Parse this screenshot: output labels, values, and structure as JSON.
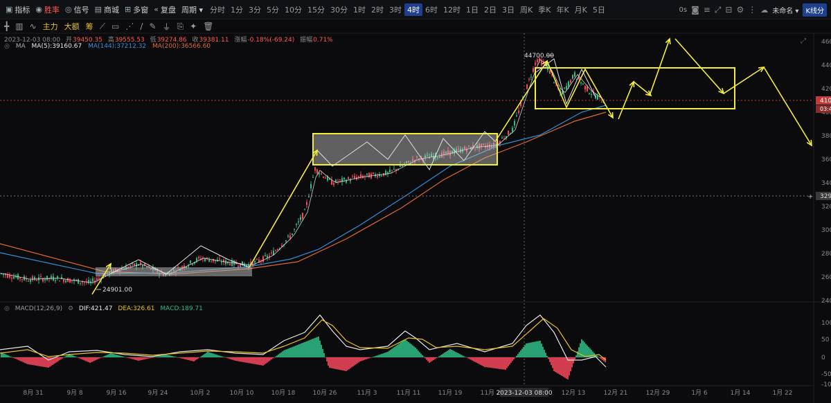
{
  "toolbar": {
    "items": [
      {
        "name": "indicators-button",
        "icon": "indicator-icon",
        "glyph": "▣",
        "label": "指标",
        "style": ""
      },
      {
        "name": "win-rate-button",
        "icon": "win-icon",
        "glyph": "◉",
        "label": "胜率",
        "style": "red"
      },
      {
        "name": "signal-button",
        "icon": "signal-icon",
        "glyph": "◎",
        "label": "信号",
        "style": ""
      },
      {
        "name": "tools-button",
        "icon": "shop-icon",
        "glyph": "▤",
        "label": "商城",
        "style": ""
      },
      {
        "name": "multi-chart-button",
        "icon": "grid-icon",
        "glyph": "⊞",
        "label": "多窗",
        "style": ""
      },
      {
        "name": "replay-button",
        "icon": "replay-icon",
        "glyph": "«",
        "label": "复盘",
        "style": ""
      },
      {
        "name": "period-button",
        "icon": "",
        "glyph": "",
        "label": "周期 ▾",
        "style": ""
      }
    ],
    "timeframes": [
      "分时",
      "1分",
      "3分",
      "5分",
      "10分",
      "15分",
      "30分",
      "1时",
      "2时",
      "3时",
      "4时",
      "6时",
      "12时",
      "1日",
      "2日",
      "3日",
      "周K",
      "季K",
      "年K",
      "月K",
      "5日"
    ],
    "active_timeframe": "4时",
    "right": {
      "countdown": "0s",
      "layout_label": "未命名 ▾",
      "kline_label": "K线分"
    }
  },
  "drawing_tools": [
    {
      "name": "crosshair-icon",
      "glyph": "╋"
    },
    {
      "name": "candle-type-icon",
      "glyph": "▥"
    },
    {
      "name": "wave-icon",
      "glyph": "∿"
    },
    {
      "name": "main-force-label",
      "text": "主力"
    },
    {
      "name": "big-order-label",
      "text": "大额"
    },
    {
      "name": "chips-label",
      "text": "筹"
    },
    {
      "name": "ruler-icon",
      "glyph": "⟋"
    },
    {
      "name": "rectangle-tool-icon",
      "glyph": "▭"
    },
    {
      "name": "fib-tool-icon",
      "glyph": "⋰"
    },
    {
      "name": "trend-tool-icon",
      "glyph": "∕"
    },
    {
      "name": "pen-tool-icon",
      "glyph": "✎"
    },
    {
      "name": "filter-tool-icon",
      "glyph": "⏚"
    },
    {
      "name": "copy-tool-icon",
      "glyph": "⎘"
    },
    {
      "name": "magnet-tool-icon",
      "glyph": "✦"
    },
    {
      "name": "trash-icon",
      "glyph": "🗑"
    }
  ],
  "ohlc": {
    "time": "2023-12-03 08:00",
    "open_label": "开",
    "open": "39450.35",
    "high_label": "高",
    "high": "39555.53",
    "low_label": "低",
    "low": "39274.86",
    "close_label": "收",
    "close": "39381.11",
    "change_label": "涨幅",
    "change": "-0.18%(-69.24)",
    "amp_label": "振幅",
    "amp": "0.71%"
  },
  "ma": {
    "label": "MA",
    "ma5": "MA(5):39160.67",
    "ma144": "MA(144):37212.32",
    "ma200": "MA(200):36566.60"
  },
  "macd": {
    "label": "MACD(12,26,9)",
    "dif": "DIF:421.47",
    "dea": "DEA:326.61",
    "macd": "MACD:189.71"
  },
  "price_axis": [
    "460",
    "440",
    "420",
    "410",
    "400",
    "380",
    "360",
    "340",
    "329",
    "320",
    "300",
    "280",
    "260",
    "240"
  ],
  "macd_axis": [
    "100",
    "50",
    "0",
    "-50",
    "-100"
  ],
  "price_tags": {
    "current": "410",
    "current_sub": "03:4",
    "level": "329"
  },
  "annotations": {
    "high": "44700.00",
    "low": "24901.00"
  },
  "time_axis": [
    "8月 31",
    "9月 8",
    "9月 16",
    "9月 24",
    "10月 2",
    "10月 10",
    "10月 18",
    "10月 26",
    "11月 3",
    "11月 11",
    "11月 19",
    "11月 27",
    "2023-12-03 08:00",
    "12月 13",
    "12月 21",
    "12月 29",
    "1月 6",
    "1月 14",
    "1月 22"
  ],
  "colors": {
    "up": "#2ebd85",
    "down": "#f6465d",
    "ma5": "#e8e8e8",
    "ma144": "#2f8fd8",
    "ma200": "#e06a2e",
    "annotation": "#f4f03a",
    "accent": "#1f3f8f"
  }
}
